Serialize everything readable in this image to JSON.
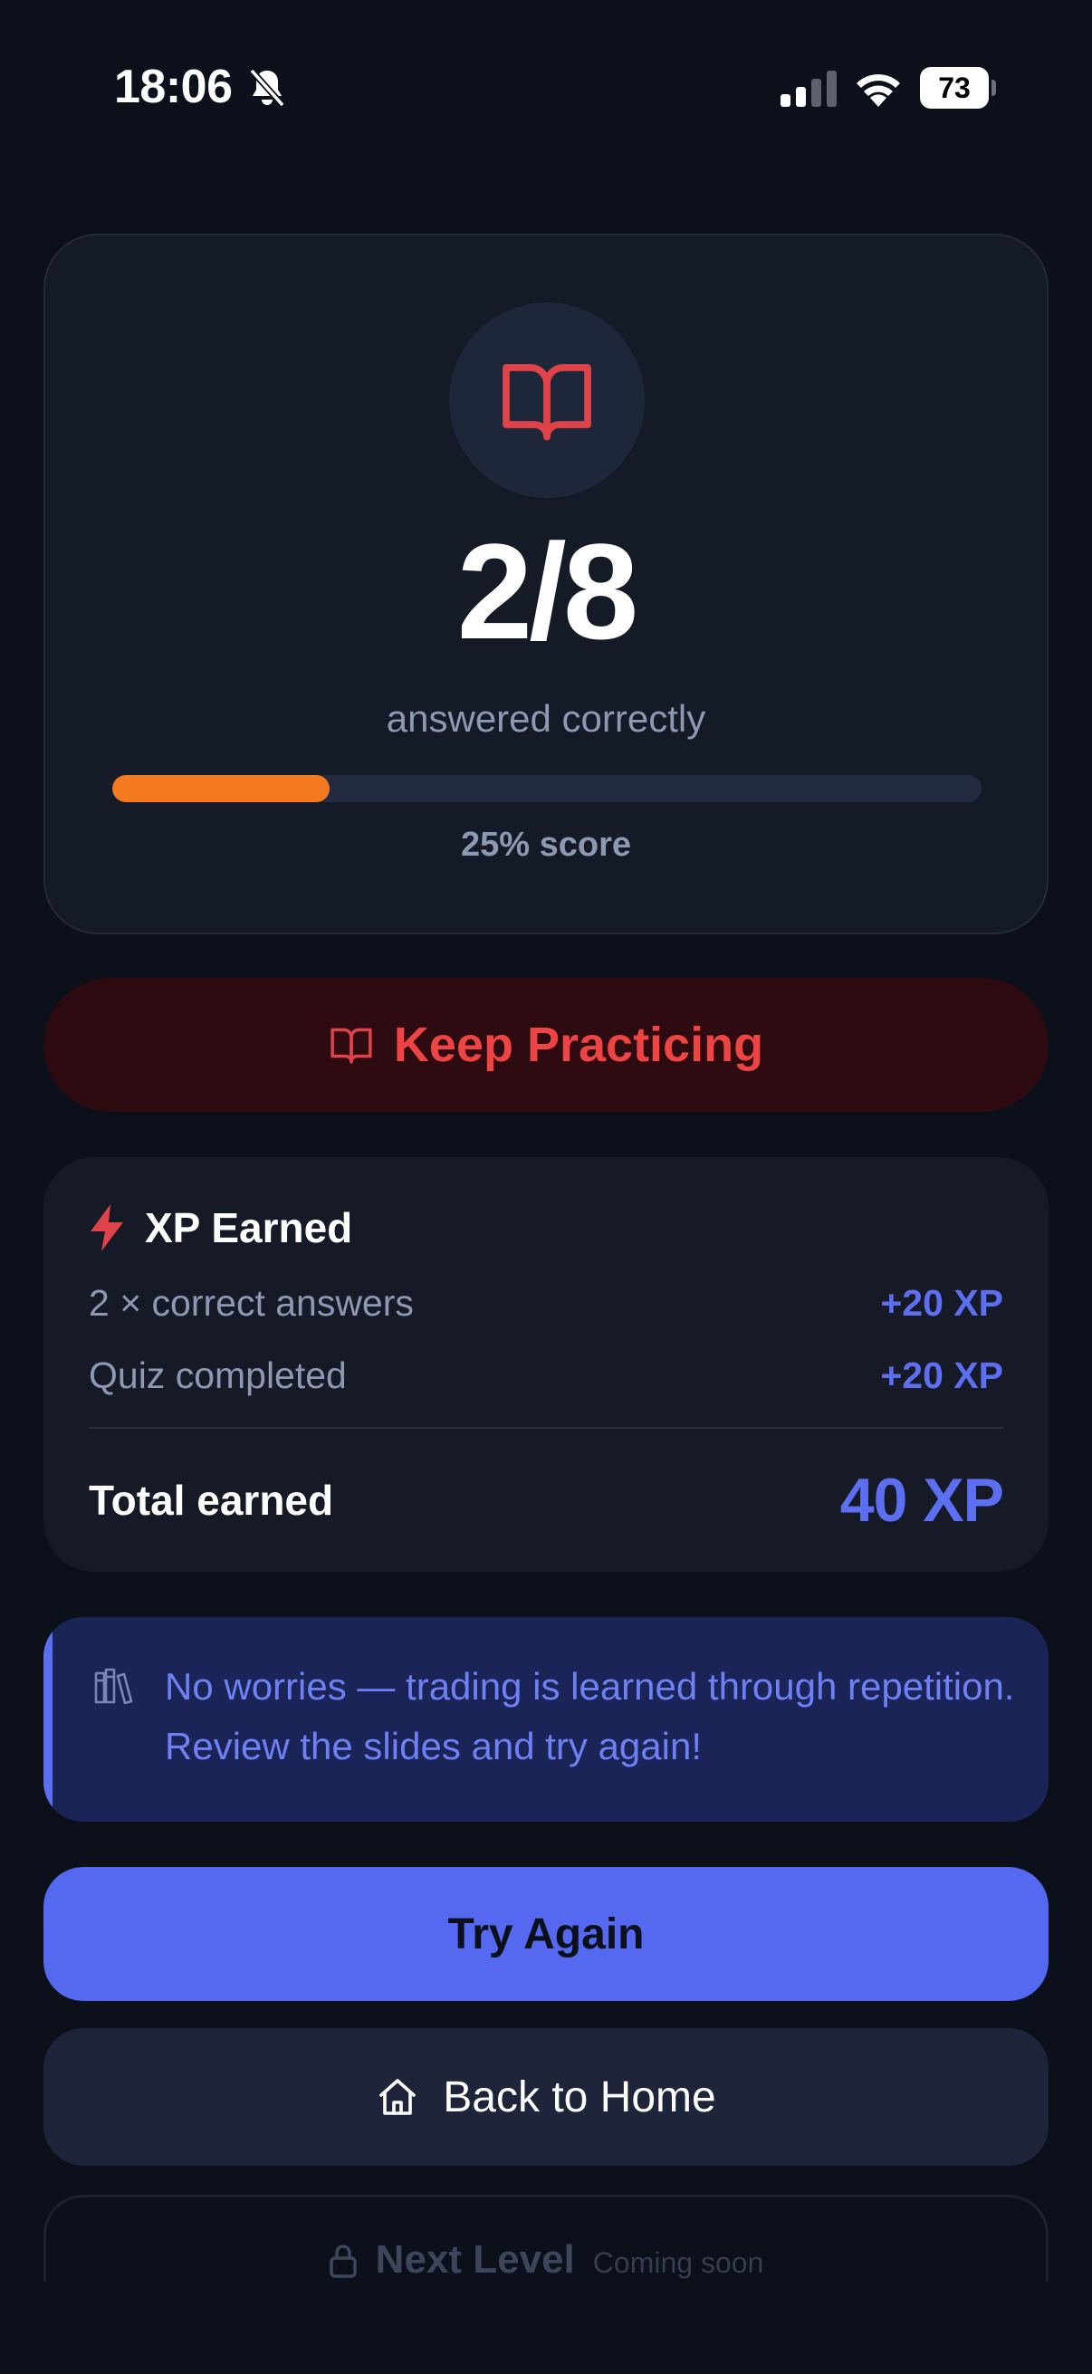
{
  "status_bar": {
    "time": "18:06",
    "battery": "73",
    "icons": [
      "bell-slash-icon",
      "signal-icon",
      "wifi-icon",
      "battery-icon"
    ]
  },
  "result": {
    "icon": "open-book-icon",
    "score": "2/8",
    "caption": "answered correctly",
    "progress_fraction": 0.25,
    "score_label": "25% score"
  },
  "banner": {
    "icon": "open-book-icon",
    "label": "Keep Practicing"
  },
  "xp": {
    "icon": "lightning-icon",
    "title": "XP Earned",
    "rows": [
      {
        "label": "2 × correct answers",
        "value": "+20 XP"
      },
      {
        "label": "Quiz completed",
        "value": "+20 XP"
      }
    ],
    "total_label": "Total earned",
    "total_value": "40 XP"
  },
  "tip": {
    "icon": "books-icon",
    "text": "No worries — trading is learned through repetition. Review the slides and try again!"
  },
  "actions": {
    "try_again": "Try Again",
    "back_home": "Back to Home",
    "next_level": "Next Level",
    "next_level_sub": "Coming soon"
  },
  "colors": {
    "background": "#0b101a",
    "card": "#151a27",
    "accent_blue": "#5568f0",
    "progress": "#f5791f",
    "warning_red": "#ee4444"
  }
}
